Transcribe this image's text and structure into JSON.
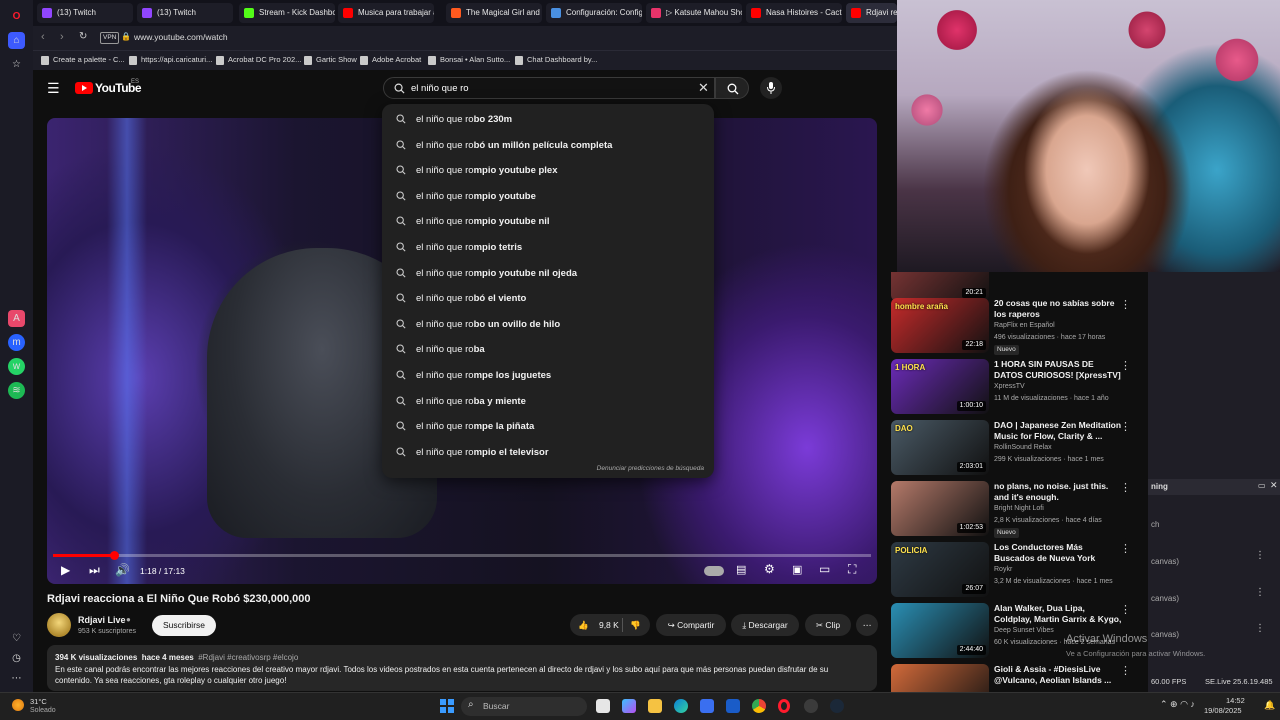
{
  "tabs": [
    {
      "label": "(13) Twitch",
      "color": "#9146ff"
    },
    {
      "label": "(13) Twitch",
      "color": "#9146ff"
    },
    {
      "label": "Stream - Kick Dashboard",
      "color": "#53fc18"
    },
    {
      "label": "Musica para trabajar activ",
      "color": "#ff0000"
    },
    {
      "label": "The Magical Girl and the E",
      "color": "#ff5a1f"
    },
    {
      "label": "Configuración: Configurar",
      "color": "#4a90e2"
    },
    {
      "label": "▷ Katsute Mahou Shoujo",
      "color": "#e8336a"
    },
    {
      "label": "Nasa Histoires - Cactus -",
      "color": "#ff0000"
    },
    {
      "label": "Rdjavi reacc",
      "color": "#ff0000"
    }
  ],
  "address": {
    "vpn": "VPN",
    "url": "www.youtube.com/watch"
  },
  "bookmarks": [
    "Create a palette - C...",
    "https://api.caricaturi...",
    "Acrobat DC Pro 202...",
    "Gartic Show",
    "Adobe Acrobat",
    "Bonsai • Alan Sutto...",
    "Chat Dashboard by..."
  ],
  "youtube": {
    "logo": "YouTube",
    "region": "ES",
    "search_value": "el niño que ro",
    "suggest_prefix": "el niño que ro",
    "suggestions": [
      {
        "pre": "el niño que ro",
        "bold": "bo 230m"
      },
      {
        "pre": "el niño que ro",
        "bold": "bó un millón película completa"
      },
      {
        "pre": "el niño que ro",
        "bold": "mpio youtube plex"
      },
      {
        "pre": "el niño que ro",
        "bold": "mpio youtube"
      },
      {
        "pre": "el niño que ro",
        "bold": "mpio youtube nil"
      },
      {
        "pre": "el niño que ro",
        "bold": "mpio tetris"
      },
      {
        "pre": "el niño que ro",
        "bold": "mpio youtube nil ojeda"
      },
      {
        "pre": "el niño que ro",
        "bold": "bó el viento"
      },
      {
        "pre": "el niño que ro",
        "bold": "bo un ovillo de hilo"
      },
      {
        "pre": "el niño que ro",
        "bold": "ba"
      },
      {
        "pre": "el niño que ro",
        "bold": "mpe los juguetes"
      },
      {
        "pre": "el niño que ro",
        "bold": "ba y miente"
      },
      {
        "pre": "el niño que ro",
        "bold": "mpe la piñata"
      },
      {
        "pre": "el niño que ro",
        "bold": "mpio el televisor"
      }
    ],
    "report_predictions": "Denunciar predicciones de búsqueda",
    "player": {
      "time": "1:18 / 17:13",
      "progress": 0.075
    },
    "video_title": "Rdjavi reacciona a El Niño Que Robó $230,000,000",
    "channel": {
      "name": "Rdjavi Live",
      "subs": "953 K suscriptores",
      "subscribe": "Suscribirse"
    },
    "actions": {
      "likes": "9,8 K",
      "share": "Compartir",
      "download": "Descargar",
      "clip": "Clip",
      "more": "⋯"
    },
    "description": {
      "views": "394 K visualizaciones",
      "age": "hace 4 meses",
      "tags": "#Rdjavi #creativosrp #elcojo",
      "text": "En este canal podrás encontrar las mejores reacciones del creativo mayor rdjavi. Todos los videos postrados en esta cuenta pertenecen al directo de rdjavi y los subo aquí para que más personas puedan disfrutar de su contenido. Ya sea reacciones, gta roleplay o cualquier otro juego!"
    }
  },
  "related": [
    {
      "title": "",
      "channel": "",
      "meta": "1,4 M de visualizaciones · hace 1 año",
      "duration": "20:21",
      "badge": "",
      "thumb": "#8a3a3a"
    },
    {
      "title": "20 cosas que no sabías sobre los raperos",
      "channel": "RapFlix en Español",
      "meta": "496 visualizaciones · hace 17 horas",
      "duration": "22:18",
      "badge": "Nuevo",
      "thumb": "#c72b2b",
      "overlay": "hombre araña"
    },
    {
      "title": "1 HORA SIN PAUSAS DE DATOS CURIOSOS! [XpressTV]",
      "channel": "XpressTV",
      "meta": "11 M de visualizaciones · hace 1 año",
      "duration": "1:00:10",
      "badge": "",
      "thumb": "#6b2bb8",
      "overlay": "1 HORA"
    },
    {
      "title": "DAO | Japanese Zen Meditation Music for Flow, Clarity & ...",
      "channel": "RollinSound Relax",
      "meta": "299 K visualizaciones · hace 1 mes",
      "duration": "2:03:01",
      "badge": "",
      "thumb": "#4a5a66",
      "overlay": "DAO"
    },
    {
      "title": "no plans, no noise. just this. and it's enough.",
      "channel": "Bright Night Lofi",
      "meta": "2,8 K visualizaciones · hace 4 días",
      "duration": "1:02:53",
      "badge": "Nuevo",
      "thumb": "#b57a6a"
    },
    {
      "title": "Los Conductores Más Buscados de Nueva York",
      "channel": "Roykr",
      "meta": "3,2 M de visualizaciones · hace 1 mes",
      "duration": "26:07",
      "badge": "",
      "thumb": "#2e3a44",
      "overlay": "POLICIA"
    },
    {
      "title": "Alan Walker, Dua Lipa, Coldplay, Martin Garrix & Kygo, The ...",
      "channel": "Deep Sunset Vibes",
      "meta": "60 K visualizaciones · hace 2 semanas",
      "duration": "2:44:40",
      "badge": "",
      "thumb": "#2a8fb4"
    },
    {
      "title": "Gioli & Assia - #DiesisLive @Vulcano, Aeolian Islands ...",
      "channel": "",
      "meta": "",
      "duration": "",
      "badge": "",
      "thumb": "#d26a3a"
    }
  ],
  "obs": {
    "header": "ning",
    "row1": "ch",
    "row2": "canvas)",
    "row3": "canvas)",
    "row4": "canvas)",
    "fps": "60.00 FPS",
    "version": "SE.Live 25.6.19.485"
  },
  "windows_watermark": {
    "title": "Activar Windows",
    "subtitle": "Ve a Configuración para activar Windows."
  },
  "taskbar": {
    "temp": "31°C",
    "weather": "Soleado",
    "search": "Buscar",
    "time": "14:52",
    "date": "19/08/2025"
  }
}
